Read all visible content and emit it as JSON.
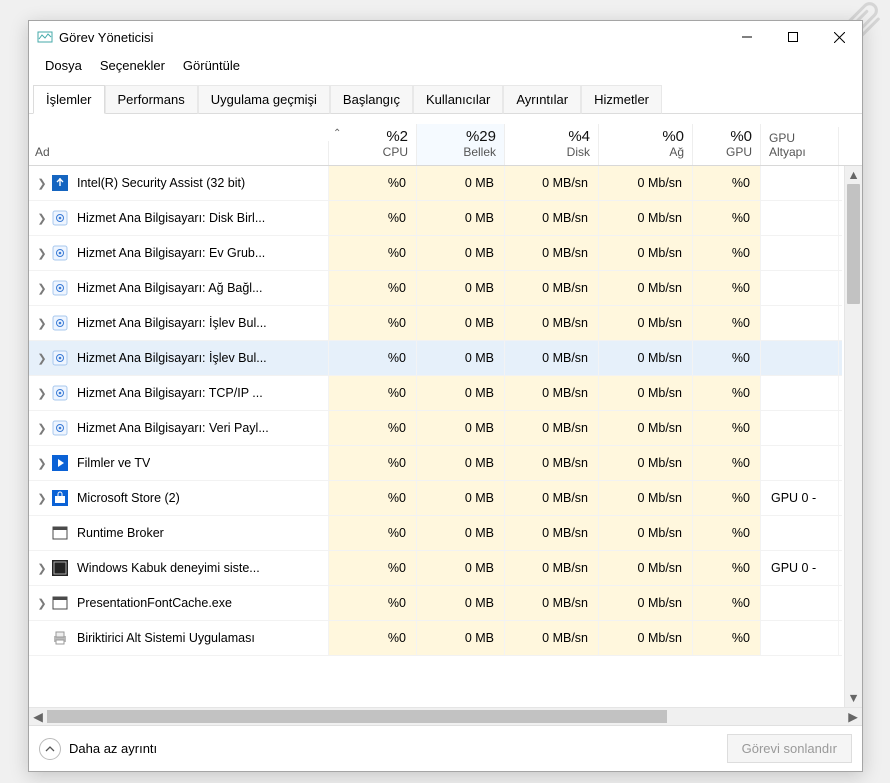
{
  "window": {
    "title": "Görev Yöneticisi"
  },
  "menu": [
    "Dosya",
    "Seçenekler",
    "Görüntüle"
  ],
  "tabs": [
    "İşlemler",
    "Performans",
    "Uygulama geçmişi",
    "Başlangıç",
    "Kullanıcılar",
    "Ayrıntılar",
    "Hizmetler"
  ],
  "activeTab": 0,
  "columns": {
    "name": {
      "value": "",
      "label": "Ad"
    },
    "cpu": {
      "value": "%2",
      "label": "CPU"
    },
    "memory": {
      "value": "%29",
      "label": "Bellek"
    },
    "disk": {
      "value": "%4",
      "label": "Disk"
    },
    "net": {
      "value": "%0",
      "label": "Ağ"
    },
    "gpu": {
      "value": "%0",
      "label": "GPU"
    },
    "gpue": {
      "value": "",
      "label": "GPU Altyapı"
    }
  },
  "sortColumn": "cpu",
  "rows": [
    {
      "expand": true,
      "icon": "security",
      "name": "Intel(R) Security Assist (32 bit)",
      "cpu": "%0",
      "mem": "0 MB",
      "disk": "0 MB/sn",
      "net": "0 Mb/sn",
      "gpu": "%0",
      "gpue": ""
    },
    {
      "expand": true,
      "icon": "gear",
      "name": "Hizmet Ana Bilgisayarı: Disk Birl...",
      "cpu": "%0",
      "mem": "0 MB",
      "disk": "0 MB/sn",
      "net": "0 Mb/sn",
      "gpu": "%0",
      "gpue": ""
    },
    {
      "expand": true,
      "icon": "gear",
      "name": "Hizmet Ana Bilgisayarı: Ev Grub...",
      "cpu": "%0",
      "mem": "0 MB",
      "disk": "0 MB/sn",
      "net": "0 Mb/sn",
      "gpu": "%0",
      "gpue": ""
    },
    {
      "expand": true,
      "icon": "gear",
      "name": "Hizmet Ana Bilgisayarı: Ağ Bağl...",
      "cpu": "%0",
      "mem": "0 MB",
      "disk": "0 MB/sn",
      "net": "0 Mb/sn",
      "gpu": "%0",
      "gpue": ""
    },
    {
      "expand": true,
      "icon": "gear",
      "name": "Hizmet Ana Bilgisayarı: İşlev Bul...",
      "cpu": "%0",
      "mem": "0 MB",
      "disk": "0 MB/sn",
      "net": "0 Mb/sn",
      "gpu": "%0",
      "gpue": ""
    },
    {
      "expand": true,
      "icon": "gear",
      "name": "Hizmet Ana Bilgisayarı: İşlev Bul...",
      "cpu": "%0",
      "mem": "0 MB",
      "disk": "0 MB/sn",
      "net": "0 Mb/sn",
      "gpu": "%0",
      "gpue": "",
      "selected": true
    },
    {
      "expand": true,
      "icon": "gear",
      "name": "Hizmet Ana Bilgisayarı: TCP/IP ...",
      "cpu": "%0",
      "mem": "0 MB",
      "disk": "0 MB/sn",
      "net": "0 Mb/sn",
      "gpu": "%0",
      "gpue": ""
    },
    {
      "expand": true,
      "icon": "gear",
      "name": "Hizmet Ana Bilgisayarı: Veri Payl...",
      "cpu": "%0",
      "mem": "0 MB",
      "disk": "0 MB/sn",
      "net": "0 Mb/sn",
      "gpu": "%0",
      "gpue": ""
    },
    {
      "expand": true,
      "icon": "film",
      "name": "Filmler ve TV",
      "cpu": "%0",
      "mem": "0 MB",
      "disk": "0 MB/sn",
      "net": "0 Mb/sn",
      "gpu": "%0",
      "gpue": ""
    },
    {
      "expand": true,
      "icon": "store",
      "name": "Microsoft Store (2)",
      "cpu": "%0",
      "mem": "0 MB",
      "disk": "0 MB/sn",
      "net": "0 Mb/sn",
      "gpu": "%0",
      "gpue": "GPU 0 - "
    },
    {
      "expand": false,
      "icon": "window",
      "name": "Runtime Broker",
      "cpu": "%0",
      "mem": "0 MB",
      "disk": "0 MB/sn",
      "net": "0 Mb/sn",
      "gpu": "%0",
      "gpue": ""
    },
    {
      "expand": true,
      "icon": "shell",
      "name": "Windows Kabuk deneyimi siste...",
      "cpu": "%0",
      "mem": "0 MB",
      "disk": "0 MB/sn",
      "net": "0 Mb/sn",
      "gpu": "%0",
      "gpue": "GPU 0 - "
    },
    {
      "expand": true,
      "icon": "window",
      "name": "PresentationFontCache.exe",
      "cpu": "%0",
      "mem": "0 MB",
      "disk": "0 MB/sn",
      "net": "0 Mb/sn",
      "gpu": "%0",
      "gpue": ""
    },
    {
      "expand": false,
      "icon": "printer",
      "name": "Biriktirici Alt Sistemi Uygulaması",
      "cpu": "%0",
      "mem": "0 MB",
      "disk": "0 MB/sn",
      "net": "0 Mb/sn",
      "gpu": "%0",
      "gpue": ""
    }
  ],
  "footer": {
    "fewerDetails": "Daha az ayrıntı",
    "endTask": "Görevi sonlandır"
  }
}
